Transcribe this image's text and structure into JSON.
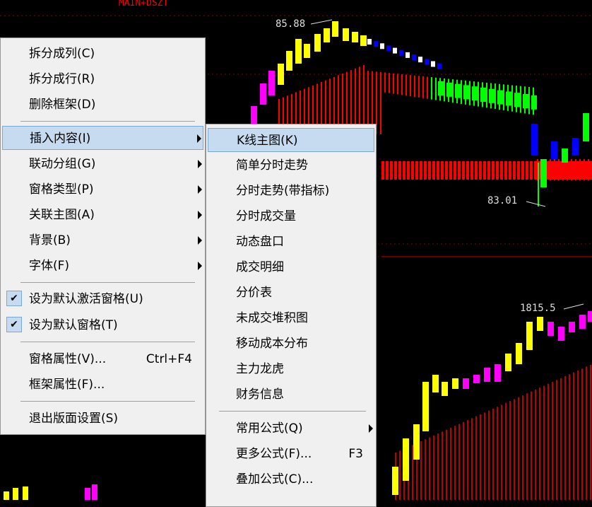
{
  "chart": {
    "indicator_label": "MAIN+DSZT",
    "price_high": "85.88",
    "price_low": "83.01",
    "volume_high": "1815.5"
  },
  "colors": {
    "up": "#ffff00",
    "down": "#00ff00",
    "magenta": "#ff00ff",
    "blue": "#0000ff",
    "red": "#ff0000",
    "menu_highlight": "#c6dbf0"
  },
  "menu": {
    "items": [
      {
        "label": "拆分成列(C)"
      },
      {
        "label": "拆分成行(R)"
      },
      {
        "label": "删除框架(D)"
      },
      {
        "label": "插入内容(I)"
      },
      {
        "label": "联动分组(G)"
      },
      {
        "label": "窗格类型(P)"
      },
      {
        "label": "关联主图(A)"
      },
      {
        "label": "背景(B)"
      },
      {
        "label": "字体(F)"
      },
      {
        "label": "设为默认激活窗格(U)",
        "checked": true
      },
      {
        "label": "设为默认窗格(T)",
        "checked": true
      },
      {
        "label": "窗格属性(V)...",
        "shortcut": "Ctrl+F4"
      },
      {
        "label": "框架属性(F)..."
      },
      {
        "label": "退出版面设置(S)"
      }
    ]
  },
  "submenu": {
    "items": [
      {
        "label": "K线主图(K)"
      },
      {
        "label": "简单分时走势"
      },
      {
        "label": "分时走势(带指标)"
      },
      {
        "label": "分时成交量"
      },
      {
        "label": "动态盘口"
      },
      {
        "label": "成交明细"
      },
      {
        "label": "分价表"
      },
      {
        "label": "未成交堆积图"
      },
      {
        "label": "移动成本分布"
      },
      {
        "label": "主力龙虎"
      },
      {
        "label": "财务信息"
      },
      {
        "label": "常用公式(Q)"
      },
      {
        "label": "更多公式(F)...",
        "shortcut": "F3"
      },
      {
        "label": "叠加公式(C)..."
      }
    ]
  }
}
